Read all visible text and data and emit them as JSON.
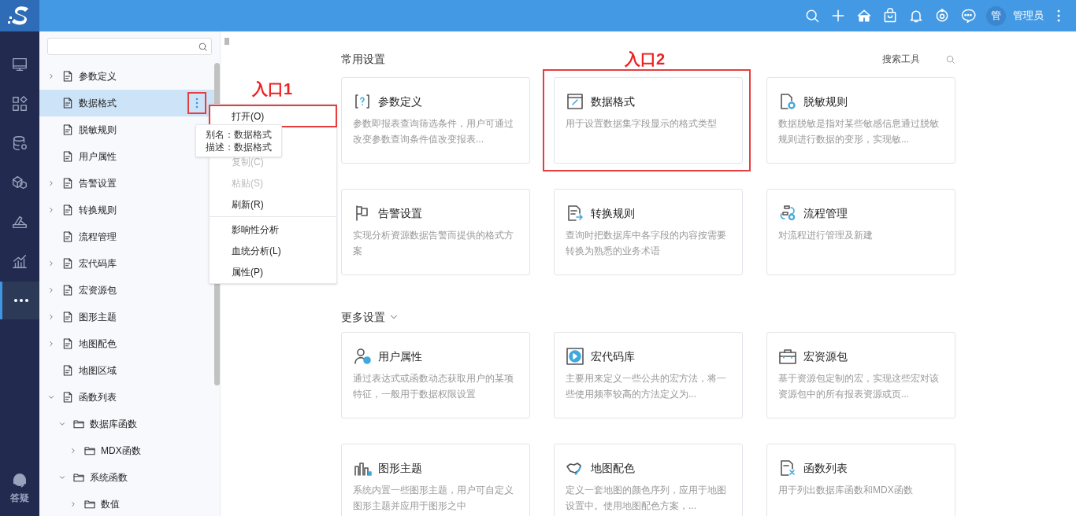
{
  "topbar": {
    "avatar": "管",
    "user": "管理员"
  },
  "rail": {
    "items": [
      {
        "selected": false
      },
      {
        "selected": false
      },
      {
        "selected": false
      },
      {
        "selected": false
      },
      {
        "selected": false
      },
      {
        "selected": false
      },
      {
        "selected": true
      }
    ],
    "help": "答疑"
  },
  "sidebar": {
    "tree": [
      {
        "label": "参数定义",
        "kind": "item",
        "expanded": false,
        "selected": false
      },
      {
        "label": "数据格式",
        "kind": "item",
        "selected": true
      },
      {
        "label": "脱敏规则",
        "kind": "item",
        "selected": false
      },
      {
        "label": "用户属性",
        "kind": "item",
        "selected": false
      },
      {
        "label": "告警设置",
        "kind": "item",
        "expanded": false,
        "selected": false
      },
      {
        "label": "转换规则",
        "kind": "item",
        "expanded": false,
        "selected": false
      },
      {
        "label": "流程管理",
        "kind": "item",
        "selected": false
      },
      {
        "label": "宏代码库",
        "kind": "item",
        "expanded": false,
        "selected": false
      },
      {
        "label": "宏资源包",
        "kind": "item",
        "expanded": false,
        "selected": false
      },
      {
        "label": "图形主题",
        "kind": "item",
        "expanded": false,
        "selected": false
      },
      {
        "label": "地图配色",
        "kind": "item",
        "expanded": false,
        "selected": false
      },
      {
        "label": "地图区域",
        "kind": "item",
        "selected": false
      },
      {
        "label": "函数列表",
        "kind": "item",
        "expanded": true,
        "selected": false,
        "children": [
          {
            "label": "数据库函数",
            "kind": "folder",
            "expanded": true,
            "selected": false,
            "children": [
              {
                "label": "MDX函数",
                "kind": "folder",
                "expanded": false,
                "selected": false
              }
            ]
          },
          {
            "label": "系统函数",
            "kind": "folder",
            "expanded": true,
            "selected": false,
            "children": [
              {
                "label": "数值",
                "kind": "folder",
                "expanded": false,
                "selected": false
              }
            ]
          }
        ]
      }
    ],
    "more_button_highlighted": true
  },
  "context_menu": {
    "groups": [
      [
        {
          "label": "打开(O)",
          "disabled": false,
          "highlighted": true
        },
        {
          "label": "复制(C)",
          "disabled": true,
          "highlighted": false
        },
        {
          "label": "粘贴(S)",
          "disabled": true,
          "highlighted": false
        },
        {
          "label": "刷新(R)",
          "disabled": false,
          "highlighted": false
        }
      ],
      [
        {
          "label": "影响性分析",
          "disabled": false,
          "highlighted": false
        },
        {
          "label": "血统分析(L)",
          "disabled": false,
          "highlighted": false
        },
        {
          "label": "属性(P)",
          "disabled": false,
          "highlighted": false
        }
      ]
    ]
  },
  "tooltip": {
    "lines": [
      "别名：数据格式",
      "描述：数据格式"
    ]
  },
  "annotations": [
    "入口1",
    "入口2"
  ],
  "main": {
    "search_label": "搜索工具",
    "sections": [
      {
        "title": "常用设置",
        "cards": [
          {
            "title": "参数定义",
            "desc": "参数即报表查询筛选条件，用户可通过改变参数查询条件值改变报表...",
            "highlighted": false
          },
          {
            "title": "数据格式",
            "desc": "用于设置数据集字段显示的格式类型",
            "highlighted": true
          },
          {
            "title": "脱敏规则",
            "desc": "数据脱敏是指对某些敏感信息通过脱敏规则进行数据的变形，实现敏...",
            "highlighted": false
          },
          {
            "title": "告警设置",
            "desc": "实现分析资源数据告警而提供的格式方案",
            "highlighted": false
          },
          {
            "title": "转换规则",
            "desc": "查询时把数据库中各字段的内容按需要转换为熟悉的业务术语",
            "highlighted": false
          },
          {
            "title": "流程管理",
            "desc": "对流程进行管理及新建",
            "highlighted": false
          }
        ]
      },
      {
        "title": "更多设置",
        "expanded": true,
        "cards": [
          {
            "title": "用户属性",
            "desc": "通过表达式或函数动态获取用户的某项特征，一般用于数据权限设置",
            "highlighted": false
          },
          {
            "title": "宏代码库",
            "desc": "主要用来定义一些公共的宏方法，将一些使用频率较高的方法定义为...",
            "highlighted": false
          },
          {
            "title": "宏资源包",
            "desc": "基于资源包定制的宏，实现这些宏对该资源包中的所有报表资源或页...",
            "highlighted": false
          },
          {
            "title": "图形主题",
            "desc": "系统内置一些图形主题，用户可自定义图形主题并应用于图形之中",
            "highlighted": false
          },
          {
            "title": "地图配色",
            "desc": "定义一套地图的颜色序列，应用于地图设置中。使用地图配色方案，...",
            "highlighted": false
          },
          {
            "title": "函数列表",
            "desc": "用于列出数据库函数和MDX函数",
            "highlighted": false
          }
        ]
      }
    ]
  }
}
